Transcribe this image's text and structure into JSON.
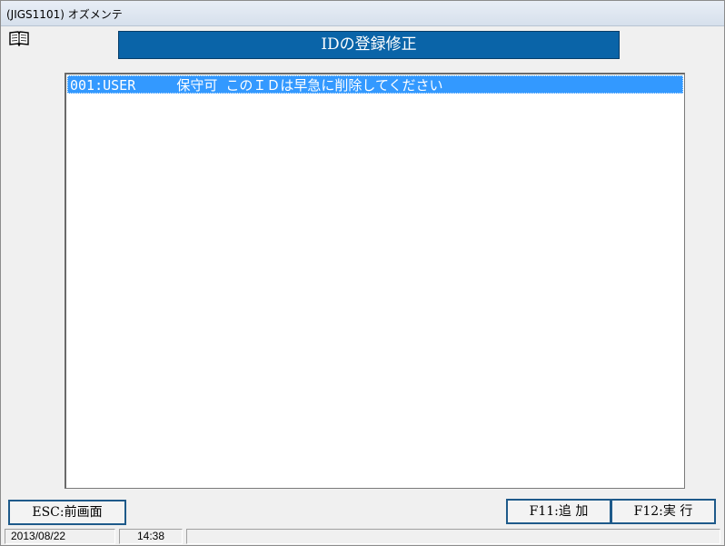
{
  "window": {
    "title": "(JIGS1101) オズメンテ"
  },
  "header": {
    "title": "IDの登録修正"
  },
  "list": {
    "items": [
      {
        "label": "001:USER     保守可 このＩＤは早急に削除してください",
        "selected": true
      }
    ]
  },
  "buttons": {
    "esc": "ESC:前画面",
    "f11": "F11:追 加",
    "f12": "F12:実 行"
  },
  "status": {
    "date": "2013/08/22",
    "time": "14:38",
    "rest": ""
  },
  "colors": {
    "header_bg": "#0a64a8",
    "selection": "#3399ff",
    "button_border": "#1e5a8a"
  },
  "icons": {
    "manual": "book-icon"
  }
}
